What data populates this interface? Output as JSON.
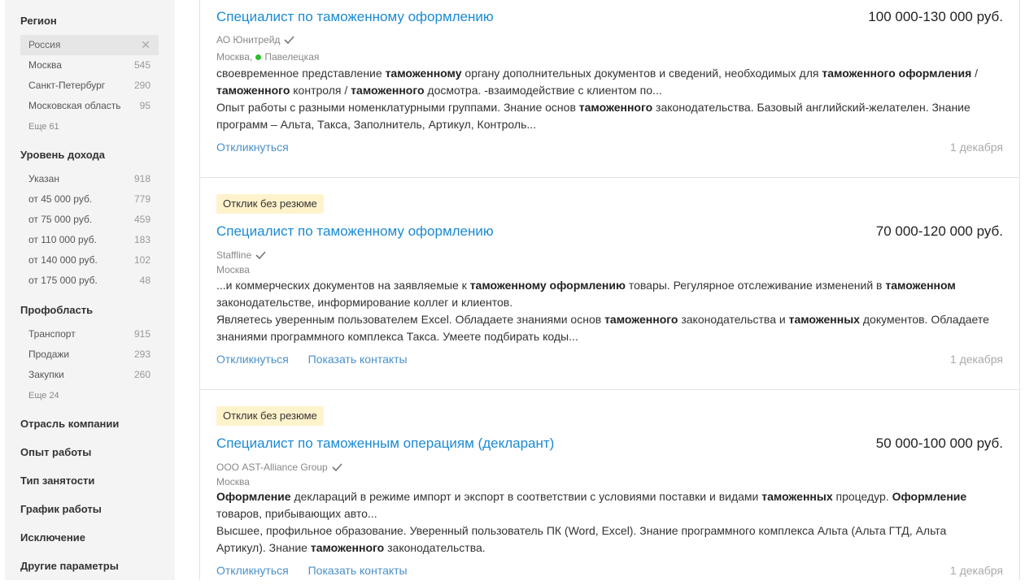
{
  "sidebar": {
    "region": {
      "title": "Регион",
      "selected": {
        "label": "Россия"
      },
      "items": [
        {
          "label": "Москва",
          "count": "545"
        },
        {
          "label": "Санкт-Петербург",
          "count": "290"
        },
        {
          "label": "Московская область",
          "count": "95"
        }
      ],
      "more": "Еще 61"
    },
    "income": {
      "title": "Уровень дохода",
      "items": [
        {
          "label": "Указан",
          "count": "918"
        },
        {
          "label": "от 45 000 руб.",
          "count": "779"
        },
        {
          "label": "от 75 000 руб.",
          "count": "459"
        },
        {
          "label": "от 110 000 руб.",
          "count": "183"
        },
        {
          "label": "от 140 000 руб.",
          "count": "102"
        },
        {
          "label": "от 175 000 руб.",
          "count": "48"
        }
      ]
    },
    "profarea": {
      "title": "Профобласть",
      "items": [
        {
          "label": "Транспорт",
          "count": "915"
        },
        {
          "label": "Продажи",
          "count": "293"
        },
        {
          "label": "Закупки",
          "count": "260"
        }
      ],
      "more": "Еще 24"
    },
    "sections": [
      "Отрасль компании",
      "Опыт работы",
      "Тип занятости",
      "График работы",
      "Исключение",
      "Другие параметры"
    ]
  },
  "vacancies": [
    {
      "badge": "",
      "title": "Специалист по таможенному оформлению",
      "salary": "100 000-130 000 руб.",
      "company": "АО Юнитрейд",
      "city": "Москва,",
      "metro": "Павелецкая",
      "resp_parts": [
        {
          "t": "своевременное представление ",
          "b": false
        },
        {
          "t": "таможенному",
          "b": true
        },
        {
          "t": " органу дополнительных документов и сведений, необходимых для ",
          "b": false
        },
        {
          "t": "таможенного оформления",
          "b": true
        },
        {
          "t": " / ",
          "b": false
        },
        {
          "t": "таможенного",
          "b": true
        },
        {
          "t": " контроля / ",
          "b": false
        },
        {
          "t": "таможенного",
          "b": true
        },
        {
          "t": " досмотра. -взаимодействие с клиентом по...",
          "b": false
        }
      ],
      "req_parts": [
        {
          "t": "Опыт работы с разными номенклатурными группами. Знание основ ",
          "b": false
        },
        {
          "t": "таможенного",
          "b": true
        },
        {
          "t": " законодательства. Базовый английский-желателен. Знание программ – Альта, Такса, Заполнитель, Артикул, Контроль...",
          "b": false
        }
      ],
      "apply": "Откликнуться",
      "contacts": "",
      "date": "1 декабря"
    },
    {
      "badge": "Отклик без резюме",
      "title": "Специалист по таможенному оформлению",
      "salary": "70 000-120 000 руб.",
      "company": "Staffline",
      "city": "Москва",
      "metro": "",
      "resp_parts": [
        {
          "t": "...и коммерческих документов на заявляемые к ",
          "b": false
        },
        {
          "t": "таможенному оформлению",
          "b": true
        },
        {
          "t": " товары. Регулярное отслеживание изменений в ",
          "b": false
        },
        {
          "t": "таможенном",
          "b": true
        },
        {
          "t": " законодательстве, информирование коллег и клиентов.",
          "b": false
        }
      ],
      "req_parts": [
        {
          "t": "Являетесь уверенным пользователем Excel. Обладаете знаниями основ ",
          "b": false
        },
        {
          "t": "таможенного",
          "b": true
        },
        {
          "t": " законодательства и ",
          "b": false
        },
        {
          "t": "таможенных",
          "b": true
        },
        {
          "t": " документов. Обладаете знаниями программного комплекса Такса. Умеете подбирать коды...",
          "b": false
        }
      ],
      "apply": "Откликнуться",
      "contacts": "Показать контакты",
      "date": "1 декабря"
    },
    {
      "badge": "Отклик без резюме",
      "title": "Специалист по таможенным операциям (декларант)",
      "salary": "50 000-100 000 руб.",
      "company": "ООО AST-Alliance Group",
      "city": "Москва",
      "metro": "",
      "resp_parts": [
        {
          "t": "Оформление",
          "b": true
        },
        {
          "t": " деклараций в режиме импорт и экспорт в соответствии с условиями поставки и видами ",
          "b": false
        },
        {
          "t": "таможенных",
          "b": true
        },
        {
          "t": " процедур. ",
          "b": false
        },
        {
          "t": "Оформление",
          "b": true
        },
        {
          "t": " товаров, прибывающих авто...",
          "b": false
        }
      ],
      "req_parts": [
        {
          "t": "Высшее, профильное образование. Уверенный пользователь ПК (Word, Excel). Знание программного комплекса Альта (Альта ГТД, Альта Артикул). Знание ",
          "b": false
        },
        {
          "t": "таможенного",
          "b": true
        },
        {
          "t": " законодательства.",
          "b": false
        }
      ],
      "apply": "Откликнуться",
      "contacts": "Показать контакты",
      "date": "1 декабря"
    }
  ]
}
